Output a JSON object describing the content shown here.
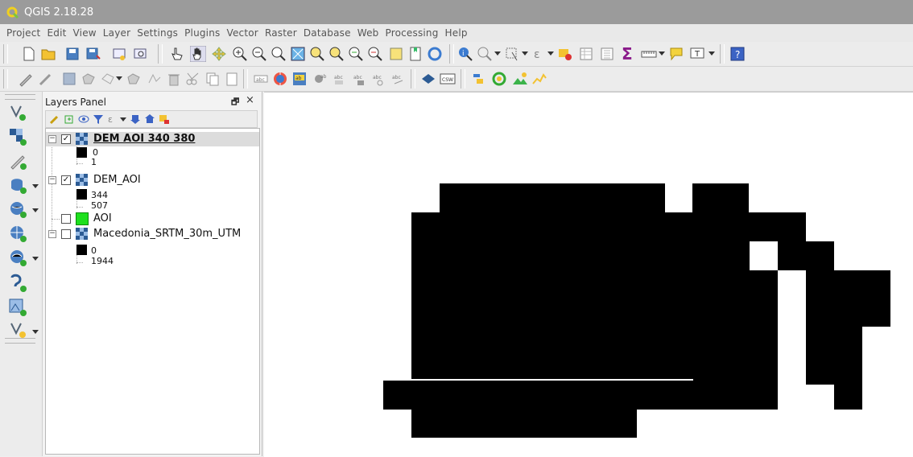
{
  "window": {
    "title": "QGIS 2.18.28"
  },
  "menu": [
    "Project",
    "Edit",
    "View",
    "Layer",
    "Settings",
    "Plugins",
    "Vector",
    "Raster",
    "Database",
    "Web",
    "Processing",
    "Help"
  ],
  "toolbar_labels": {
    "csw": "CSW"
  },
  "layers_panel": {
    "title": "Layers Panel",
    "float_glyph": "🗗",
    "close_glyph": "×",
    "layers": [
      {
        "name": "DEM AOI 340 380",
        "checked": true,
        "selected": true,
        "type": "raster",
        "legend": [
          "0",
          "1"
        ]
      },
      {
        "name": "DEM_AOI",
        "checked": true,
        "selected": false,
        "type": "raster",
        "legend": [
          "344",
          "507"
        ]
      },
      {
        "name": "AOI",
        "checked": false,
        "selected": false,
        "type": "polygon",
        "color": "#1ee01e"
      },
      {
        "name": "Macedonia_SRTM_30m_UTM",
        "checked": false,
        "selected": false,
        "type": "raster",
        "legend": [
          "0",
          "1944"
        ]
      }
    ]
  },
  "map": {
    "background": "#ffffff",
    "fill": "#000000"
  },
  "colors": {
    "titlebar": "#9b9b9b",
    "selection": "#dcdcdc",
    "aoi_green": "#1ee01e"
  }
}
